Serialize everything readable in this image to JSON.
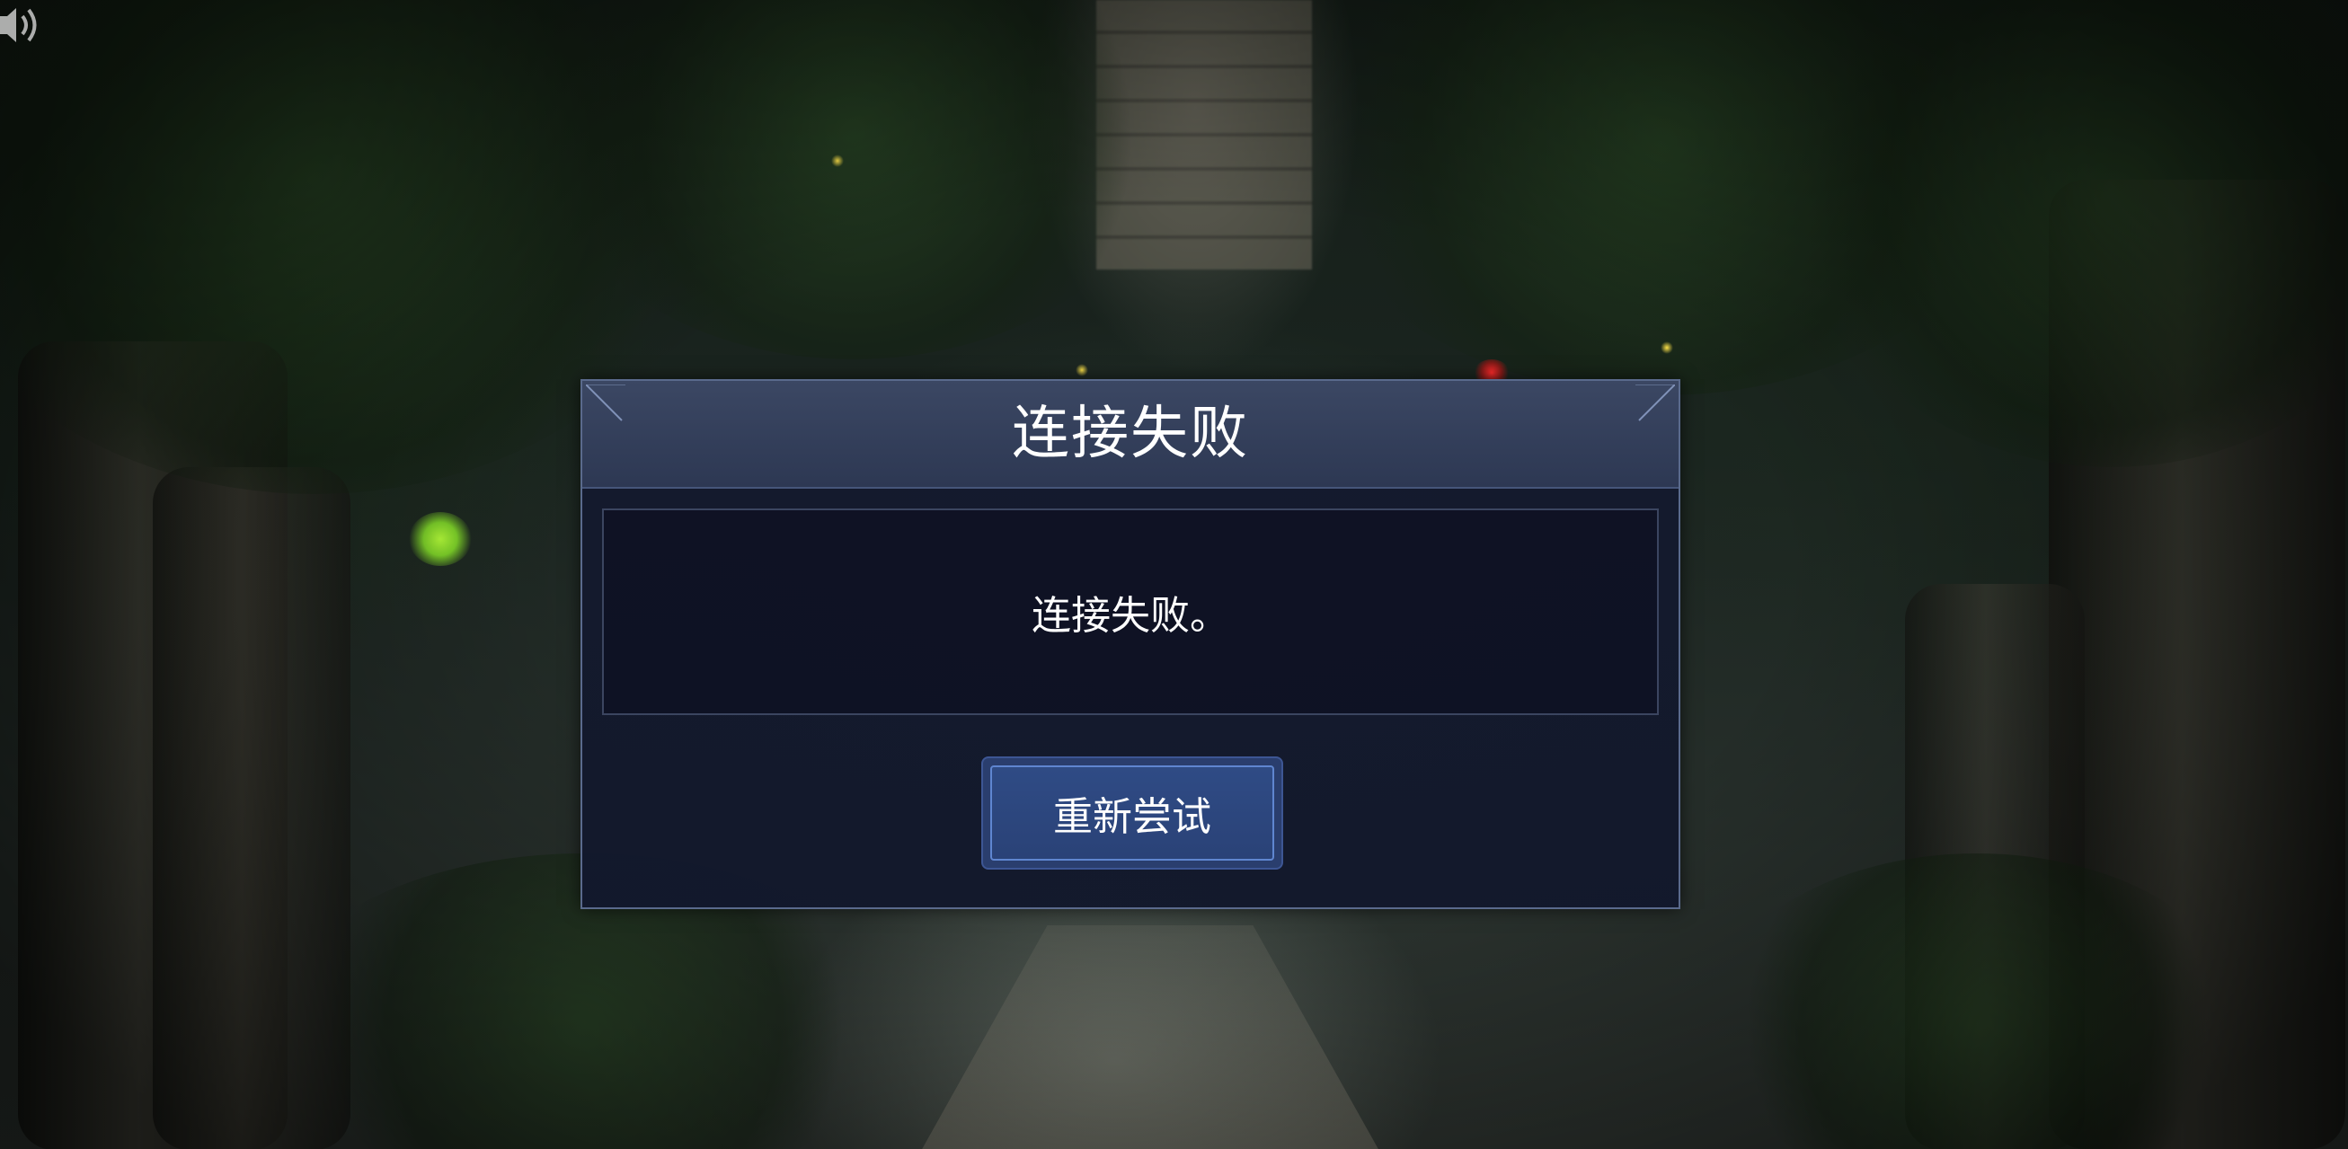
{
  "dialog": {
    "title": "连接失败",
    "message": "连接失败。",
    "retry_label": "重新尝试"
  },
  "icons": {
    "sound": "sound-icon"
  },
  "colors": {
    "dialog_header": "#3b4763",
    "dialog_body": "#141a2e",
    "dialog_border": "#5a6a8c",
    "button_fill": "#2f4b85",
    "button_border": "#5f86d0",
    "text": "#ffffff"
  }
}
